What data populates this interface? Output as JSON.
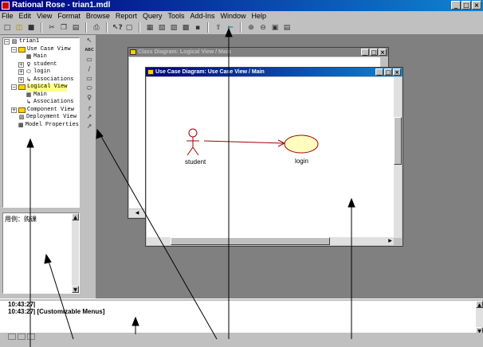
{
  "window": {
    "title": "Rational Rose - trian1.mdl",
    "controls": [
      "_",
      "□",
      "×"
    ]
  },
  "menu": {
    "items": [
      "File",
      "Edit",
      "View",
      "Format",
      "Browse",
      "Report",
      "Query",
      "Tools",
      "Add-Ins",
      "Window",
      "Help"
    ]
  },
  "toolbar": {
    "icons": [
      "new-icon",
      "open-icon",
      "save-icon",
      "cut-icon",
      "copy-icon",
      "paste-icon",
      "print-icon",
      "context-help-icon",
      "view-doc-icon",
      "browse-class-icon",
      "browse-usecase-icon",
      "browse-component-icon",
      "browse-deployment-icon",
      "browse-parent-icon",
      "browse-previous-icon",
      "zoom-in-icon",
      "zoom-out-icon",
      "fit-window-icon",
      "undo-fit-icon"
    ]
  },
  "browser": {
    "tree": [
      {
        "label": "trian1",
        "level": 0,
        "icon": "model-icon",
        "expander": "−"
      },
      {
        "label": "Use Case View",
        "level": 1,
        "icon": "folder-icon",
        "expander": "−"
      },
      {
        "label": "Main",
        "level": 2,
        "icon": "diagram-icon",
        "expander": ""
      },
      {
        "label": "student",
        "level": 2,
        "icon": "actor-icon",
        "expander": "+"
      },
      {
        "label": "login",
        "level": 2,
        "icon": "usecase-icon",
        "expander": "+"
      },
      {
        "label": "Associations",
        "level": 2,
        "icon": "association-icon",
        "expander": "+"
      },
      {
        "label": "Logical View",
        "level": 1,
        "icon": "folder-icon",
        "expander": "−",
        "selected": true
      },
      {
        "label": "Main",
        "level": 2,
        "icon": "class-diagram-icon",
        "expander": ""
      },
      {
        "label": "Associations",
        "level": 2,
        "icon": "association-icon",
        "expander": ""
      },
      {
        "label": "Component View",
        "level": 1,
        "icon": "folder-icon",
        "expander": "+"
      },
      {
        "label": "Deployment View",
        "level": 1,
        "icon": "deployment-icon",
        "expander": ""
      },
      {
        "label": "Model Properties",
        "level": 1,
        "icon": "properties-icon",
        "expander": ""
      }
    ]
  },
  "documentation": {
    "text": "用例：购课"
  },
  "toolbox": {
    "tools": [
      "↖",
      "ABC",
      "▭",
      "∕",
      "▭",
      "⬭",
      "♀",
      "┌",
      "↗",
      "↗"
    ]
  },
  "class_diagram_window": {
    "title": "Class Diagram: Logical View / Main"
  },
  "usecase_diagram_window": {
    "title": "Use Case Diagram: Use Case View / Main",
    "actor_label": "student",
    "usecase_label": "login"
  },
  "log": {
    "lines": [
      "10:43:27|",
      "10:43:27|  [Customizable Menus]"
    ]
  },
  "colors": {
    "usecase_fill": "#ffffc0",
    "association_line": "#a00000",
    "actor_stroke": "#a00000"
  }
}
